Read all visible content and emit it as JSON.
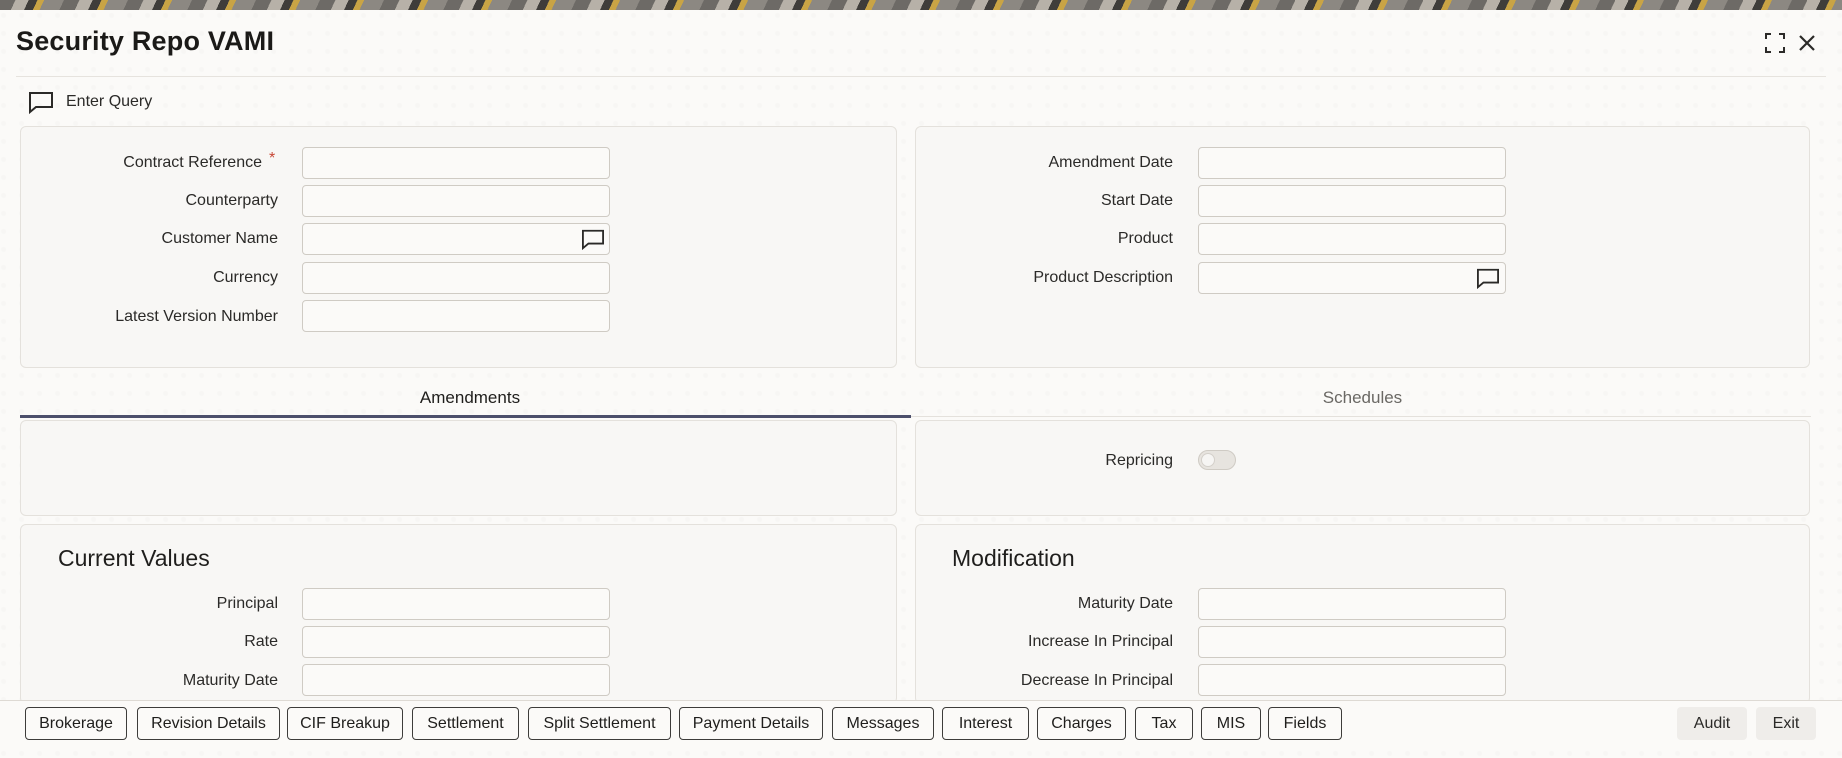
{
  "window": {
    "title": "Security Repo VAMI",
    "maximize_icon": "maximize-icon",
    "close_icon": "close-icon"
  },
  "toolbar": {
    "enter_query_label": "Enter Query",
    "enter_query_icon": "speech-bubble-icon"
  },
  "header_left": {
    "contract_reference_label": "Contract Reference",
    "required_mark": "*",
    "contract_reference_value": "",
    "counterparty_label": "Counterparty",
    "counterparty_value": "",
    "customer_name_label": "Customer Name",
    "customer_name_value": "",
    "currency_label": "Currency",
    "currency_value": "",
    "latest_version_label": "Latest Version Number",
    "latest_version_value": ""
  },
  "header_right": {
    "amendment_date_label": "Amendment Date",
    "amendment_date_value": "",
    "start_date_label": "Start Date",
    "start_date_value": "",
    "product_label": "Product",
    "product_value": "",
    "product_description_label": "Product Description",
    "product_description_value": ""
  },
  "tabs": [
    {
      "label": "Amendments",
      "active": true
    },
    {
      "label": "Schedules",
      "active": false
    }
  ],
  "schedules": {
    "repricing_label": "Repricing",
    "repricing_on": false
  },
  "current_values": {
    "title": "Current Values",
    "principal_label": "Principal",
    "principal_value": "",
    "rate_label": "Rate",
    "rate_value": "",
    "maturity_date_label": "Maturity Date",
    "maturity_date_value": ""
  },
  "modification": {
    "title": "Modification",
    "maturity_date_label": "Maturity Date",
    "maturity_date_value": "",
    "increase_principal_label": "Increase In Principal",
    "increase_principal_value": "",
    "decrease_principal_label": "Decrease In Principal",
    "decrease_principal_value": ""
  },
  "footer": {
    "buttons": [
      "Brokerage",
      "Revision Details",
      "CIF Breakup",
      "Settlement",
      "Split Settlement",
      "Payment Details",
      "Messages",
      "Interest",
      "Charges",
      "Tax",
      "MIS",
      "Fields"
    ],
    "audit_label": "Audit",
    "exit_label": "Exit"
  },
  "colors": {
    "accent_tab": "#4c4f6b",
    "required": "#c74634",
    "panel_bg": "#f8f7f5"
  }
}
